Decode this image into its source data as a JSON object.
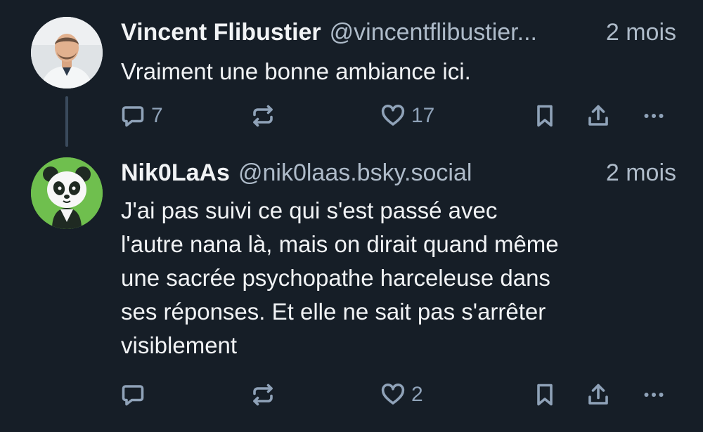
{
  "posts": [
    {
      "display_name": "Vincent Flibustier",
      "handle": "@vincentflibustier...",
      "time": "2 mois",
      "text": "Vraiment une bonne ambiance ici.",
      "reply_count": "7",
      "like_count": "17",
      "avatar_icon": "person-photo-avatar"
    },
    {
      "display_name": "Nik0LaAs",
      "handle": "@nik0laas.bsky.social",
      "time": "2 mois",
      "text": "J'ai pas suivi ce qui s'est passé avec\nl'autre nana là, mais on dirait quand même\nune sacrée psychopathe harceleuse dans\nses réponses. Et elle ne sait pas s'arrêter\nvisiblement",
      "reply_count": "",
      "like_count": "2",
      "avatar_icon": "panda-avatar"
    }
  ],
  "colors": {
    "background": "#161e27",
    "text": "#f1f3f5",
    "muted": "#aebbc9",
    "icon": "#8fa2b8",
    "thread_line": "#3a4a5c"
  }
}
